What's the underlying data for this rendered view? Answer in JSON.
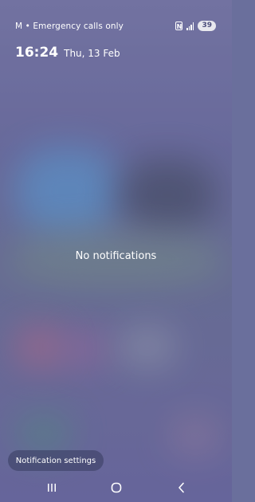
{
  "status_bar": {
    "carrier_text": "M • Emergency calls only",
    "nfc_label": "N",
    "battery_level": "39"
  },
  "lockscreen": {
    "time": "16:24",
    "date": "Thu, 13 Feb"
  },
  "notifications": {
    "empty_message": "No notifications",
    "settings_label": "Notification settings"
  },
  "nav_bar": {
    "icons": [
      "recents-icon",
      "home-icon",
      "back-icon"
    ]
  },
  "colors": {
    "background": "#6a6f9c",
    "text": "#ffffff",
    "battery_badge_bg": "#e8e8ee",
    "battery_badge_text": "#4d4f7c"
  }
}
